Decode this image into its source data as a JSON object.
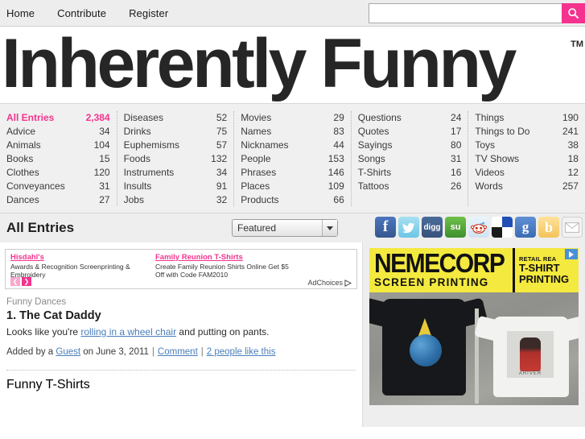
{
  "nav": {
    "items": [
      {
        "label": "Home"
      },
      {
        "label": "Contribute"
      },
      {
        "label": "Register"
      }
    ]
  },
  "search": {
    "value": "",
    "placeholder": "",
    "icon": "search-icon"
  },
  "logo": {
    "text": "Inherently Funny",
    "trademark": "TM"
  },
  "categories": {
    "columns": [
      [
        {
          "name": "All Entries",
          "count": "2,384",
          "active": true
        },
        {
          "name": "Advice",
          "count": "34"
        },
        {
          "name": "Animals",
          "count": "104"
        },
        {
          "name": "Books",
          "count": "15"
        },
        {
          "name": "Clothes",
          "count": "120"
        },
        {
          "name": "Conveyances",
          "count": "31"
        },
        {
          "name": "Dances",
          "count": "27"
        }
      ],
      [
        {
          "name": "Diseases",
          "count": "52"
        },
        {
          "name": "Drinks",
          "count": "75"
        },
        {
          "name": "Euphemisms",
          "count": "57"
        },
        {
          "name": "Foods",
          "count": "132"
        },
        {
          "name": "Instruments",
          "count": "34"
        },
        {
          "name": "Insults",
          "count": "91"
        },
        {
          "name": "Jobs",
          "count": "32"
        }
      ],
      [
        {
          "name": "Movies",
          "count": "29"
        },
        {
          "name": "Names",
          "count": "83"
        },
        {
          "name": "Nicknames",
          "count": "44"
        },
        {
          "name": "People",
          "count": "153"
        },
        {
          "name": "Phrases",
          "count": "146"
        },
        {
          "name": "Places",
          "count": "109"
        },
        {
          "name": "Products",
          "count": "66"
        }
      ],
      [
        {
          "name": "Questions",
          "count": "24"
        },
        {
          "name": "Quotes",
          "count": "17"
        },
        {
          "name": "Sayings",
          "count": "80"
        },
        {
          "name": "Songs",
          "count": "31"
        },
        {
          "name": "T-Shirts",
          "count": "16"
        },
        {
          "name": "Tattoos",
          "count": "26"
        }
      ],
      [
        {
          "name": "Things",
          "count": "190"
        },
        {
          "name": "Things to Do",
          "count": "241"
        },
        {
          "name": "Toys",
          "count": "38"
        },
        {
          "name": "TV Shows",
          "count": "18"
        },
        {
          "name": "Videos",
          "count": "12"
        },
        {
          "name": "Words",
          "count": "257"
        }
      ]
    ]
  },
  "heading": {
    "title": "All Entries",
    "sort_selected": "Featured"
  },
  "social": {
    "items": [
      {
        "name": "facebook-icon",
        "glyph": "f"
      },
      {
        "name": "twitter-icon",
        "glyph": "t"
      },
      {
        "name": "digg-icon",
        "glyph": "digg"
      },
      {
        "name": "stumbleupon-icon",
        "glyph": "su"
      },
      {
        "name": "reddit-icon",
        "glyph": ""
      },
      {
        "name": "delicious-icon",
        "glyph": ""
      },
      {
        "name": "google-icon",
        "glyph": "g"
      },
      {
        "name": "blogger-icon",
        "glyph": "b"
      },
      {
        "name": "email-icon",
        "glyph": ""
      }
    ]
  },
  "ads": {
    "units": [
      {
        "title": "Hisdahl's",
        "desc": "Awards & Recognition Screenprinting & Embroidery"
      },
      {
        "title": "Family Reunion T-Shirts",
        "desc": "Create Family Reunion Shirts Online Get $5 Off with Code FAM2010"
      }
    ],
    "adchoices_label": "AdChoices",
    "prev_glyph": "❮",
    "next_glyph": "❯"
  },
  "entries": [
    {
      "category": "Funny Dances",
      "title": "1. The Cat Daddy",
      "body_pre": "Looks like you're ",
      "body_link": "rolling in a wheel chair",
      "body_post": " and putting on pants.",
      "meta_pre": "Added by a ",
      "meta_author": "Guest",
      "meta_mid": " on June 3, 2011",
      "meta_comment": "Comment",
      "meta_likes": "2 people like this"
    }
  ],
  "next_entry": {
    "category": "Funny T-Shirts"
  },
  "sidebar_ad": {
    "brand": "NEMECORP",
    "brand_sub": "SCREEN PRINTING",
    "retail_line": "RETAIL REA",
    "line1": "T-SHIRT",
    "line2": "PRINTING",
    "shirt_caption": "ARIVER"
  },
  "colors": {
    "accent_pink": "#f5338e",
    "link_blue": "#4a7ebb",
    "nav_bg": "#ededed",
    "cats_bg": "#f0f0f0",
    "sidebar_bg": "#eeeeee",
    "ad_yellow": "#f4e93e"
  }
}
